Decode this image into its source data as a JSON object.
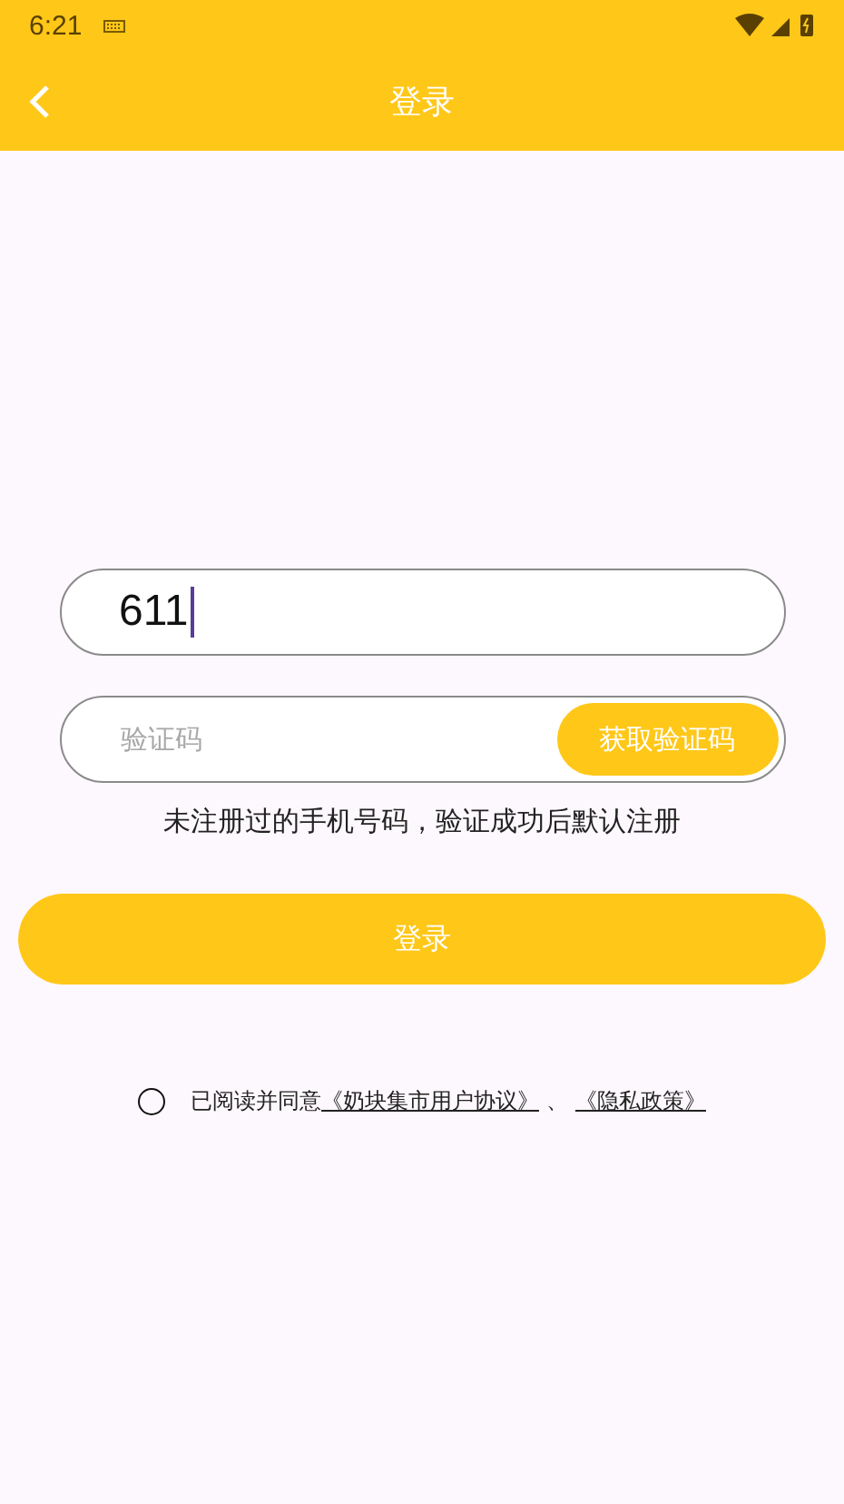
{
  "status_bar": {
    "time": "6:21"
  },
  "app_bar": {
    "title": "登录"
  },
  "phone_field": {
    "value": "611",
    "focused": true
  },
  "code_field": {
    "placeholder": "验证码",
    "button": "获取验证码"
  },
  "hint": "未注册过的手机号码，验证成功后默认注册",
  "login_button": "登录",
  "agreement": {
    "checked": false,
    "prefix": "已阅读并同意",
    "links": [
      {
        "text": "《奶块集市用户协议》"
      },
      {
        "text": "《隐私政策》"
      }
    ],
    "separator": "、"
  }
}
